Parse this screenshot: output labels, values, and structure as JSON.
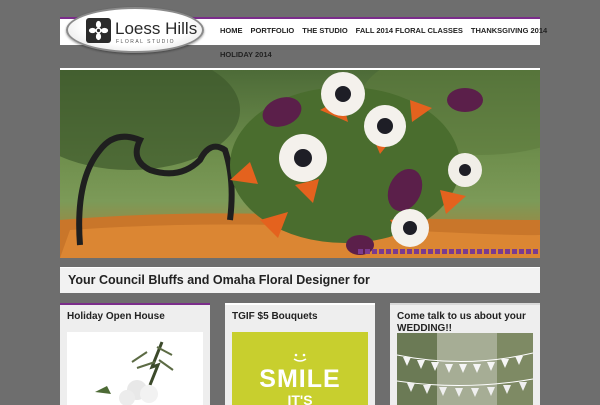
{
  "logo": {
    "title": "Loess Hills",
    "subtitle": "FLORAL STUDIO",
    "icon": "flower-icon"
  },
  "nav": {
    "items": [
      {
        "label": "HOME"
      },
      {
        "label": "PORTFOLIO"
      },
      {
        "label": "THE STUDIO"
      },
      {
        "label": "FALL 2014 FLORAL CLASSES"
      },
      {
        "label": "THANKSGIVING 2014"
      },
      {
        "label": "HOLIDAY 2014"
      }
    ]
  },
  "hero": {
    "slide_count": 32,
    "dot_color": "#7a3b8f"
  },
  "tagline": "Your Council Bluffs and Omaha Floral Designer for",
  "cards": [
    {
      "title": "Holiday Open House"
    },
    {
      "title": "TGIF $5 Bouquets",
      "image_text": "SMILE",
      "image_text_2": "IT'S"
    },
    {
      "title": "Come talk to us about your WEDDING!!"
    }
  ],
  "colors": {
    "accent": "#7b2d8b",
    "background": "#6e6e6e"
  }
}
